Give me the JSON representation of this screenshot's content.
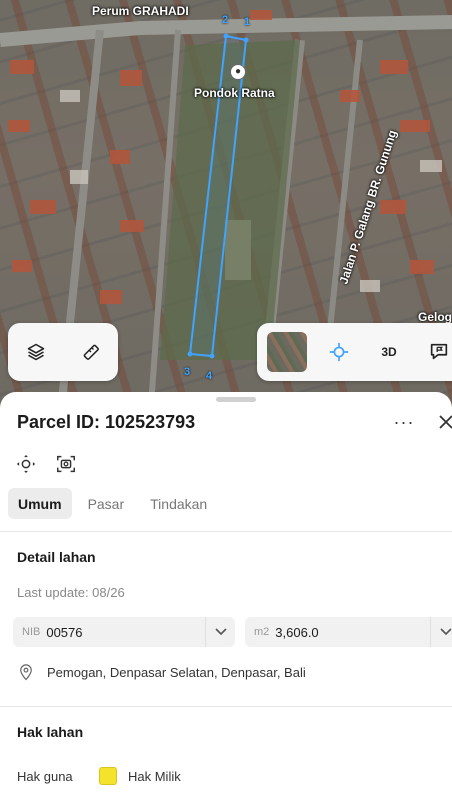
{
  "map": {
    "labels": {
      "perum": "Perum GRAHADI",
      "pondok": "Pondok Ratna",
      "jalan": "Jalan P. Galang BR. Gunung",
      "gelog": "Gelog"
    },
    "vertex_numbers": [
      "2",
      "1",
      "3",
      "4"
    ],
    "controls": {
      "layers_icon": "layers-icon",
      "measure_icon": "ruler-icon",
      "three_d_label": "3D",
      "locate_icon": "crosshair-icon",
      "feedback_icon": "chat-flag-icon"
    },
    "parcel_color": "#3fa3ff"
  },
  "sheet": {
    "title": "Parcel ID: 102523793",
    "more_label": "···",
    "tabs": [
      {
        "label": "Umum",
        "active": true
      },
      {
        "label": "Pasar",
        "active": false
      },
      {
        "label": "Tindakan",
        "active": false
      }
    ],
    "detail": {
      "section_title": "Detail lahan",
      "last_update": "Last update: 08/26",
      "nib_prefix": "NIB",
      "nib_value": "00576",
      "area_prefix": "m2",
      "area_value": "3,606.0",
      "address": "Pemogan, Denpasar Selatan, Denpasar, Bali"
    },
    "rights": {
      "section_title": "Hak lahan",
      "label": "Hak guna",
      "value": "Hak Milik",
      "swatch_color": "#f5e22a"
    }
  }
}
